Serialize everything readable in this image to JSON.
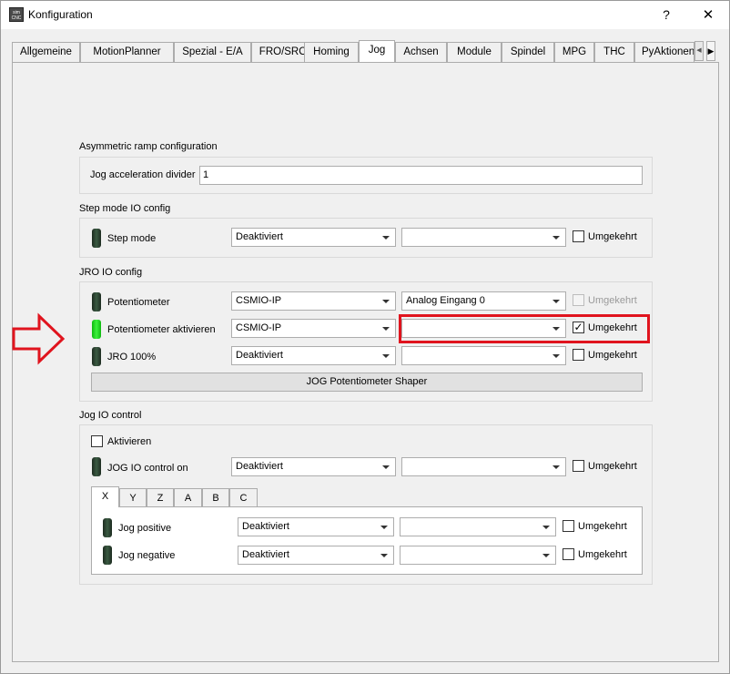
{
  "window": {
    "title": "Konfiguration",
    "help": "?",
    "close": "✕",
    "icon_text": "sim CNC"
  },
  "tabs": [
    "Allgemeine",
    "MotionPlanner",
    "Spezial - E/A",
    "FRO/SRO",
    "Homing",
    "Jog",
    "Achsen",
    "Module",
    "Spindel",
    "MPG",
    "THC",
    "PyAktionen"
  ],
  "tab_scroll": {
    "left": "◀",
    "right": "▶"
  },
  "asym": {
    "title": "Asymmetric ramp configuration",
    "divider_label": "Jog acceleration divider",
    "divider_value": "1"
  },
  "step": {
    "title": "Step mode IO config",
    "row": {
      "label": "Step mode",
      "combo1": "Deaktiviert",
      "combo2": "",
      "check_label": "Umgekehrt"
    }
  },
  "jro": {
    "title": "JRO IO config",
    "rows": [
      {
        "label": "Potentiometer",
        "combo1": "CSMIO-IP",
        "combo2": "Analog Eingang 0",
        "check_label": "Umgekehrt"
      },
      {
        "label": "Potentiometer aktivieren",
        "combo1": "CSMIO-IP",
        "combo2": "",
        "check_label": "Umgekehrt",
        "check_mark": "✓"
      },
      {
        "label": "JRO 100%",
        "combo1": "Deaktiviert",
        "combo2": "",
        "check_label": "Umgekehrt"
      }
    ],
    "shaper_button": "JOG Potentiometer Shaper"
  },
  "jogio": {
    "title": "Jog IO control",
    "enable_label": "Aktivieren",
    "row": {
      "label": "JOG IO control on",
      "combo1": "Deaktiviert",
      "combo2": "",
      "check_label": "Umgekehrt"
    },
    "axis_tabs": [
      "X",
      "Y",
      "Z",
      "A",
      "B",
      "C"
    ],
    "axis_rows": [
      {
        "label": "Jog positive",
        "combo1": "Deaktiviert",
        "combo2": "",
        "check_label": "Umgekehrt"
      },
      {
        "label": "Jog negative",
        "combo1": "Deaktiviert",
        "combo2": "",
        "check_label": "Umgekehrt"
      }
    ]
  },
  "colors": {
    "highlight_box": "#e0141e",
    "arrow": "#e0141e",
    "led_on": "#22dd22",
    "led_off": "#2a3f2e"
  }
}
